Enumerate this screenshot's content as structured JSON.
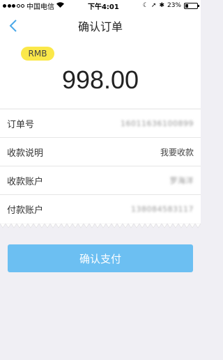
{
  "status_bar": {
    "carrier": "中国电信",
    "time": "下午4:01",
    "battery_percent": "23%",
    "battery_level": 0.23
  },
  "nav": {
    "title": "确认订单",
    "back_icon": "chevron-left-icon"
  },
  "amount": {
    "currency": "RMB",
    "value": "998.00"
  },
  "details": {
    "rows": [
      {
        "label": "订单号",
        "value": "16011636100899"
      },
      {
        "label": "收款说明",
        "value": "我要收款"
      },
      {
        "label": "收款账户",
        "value": "罗海洋"
      },
      {
        "label": "付款账户",
        "value": "138084583117"
      }
    ]
  },
  "actions": {
    "pay_label": "确认支付"
  },
  "colors": {
    "accent": "#4aa8e8",
    "button": "#6cbff2",
    "badge": "#fbe849",
    "background": "#f0eff4"
  }
}
